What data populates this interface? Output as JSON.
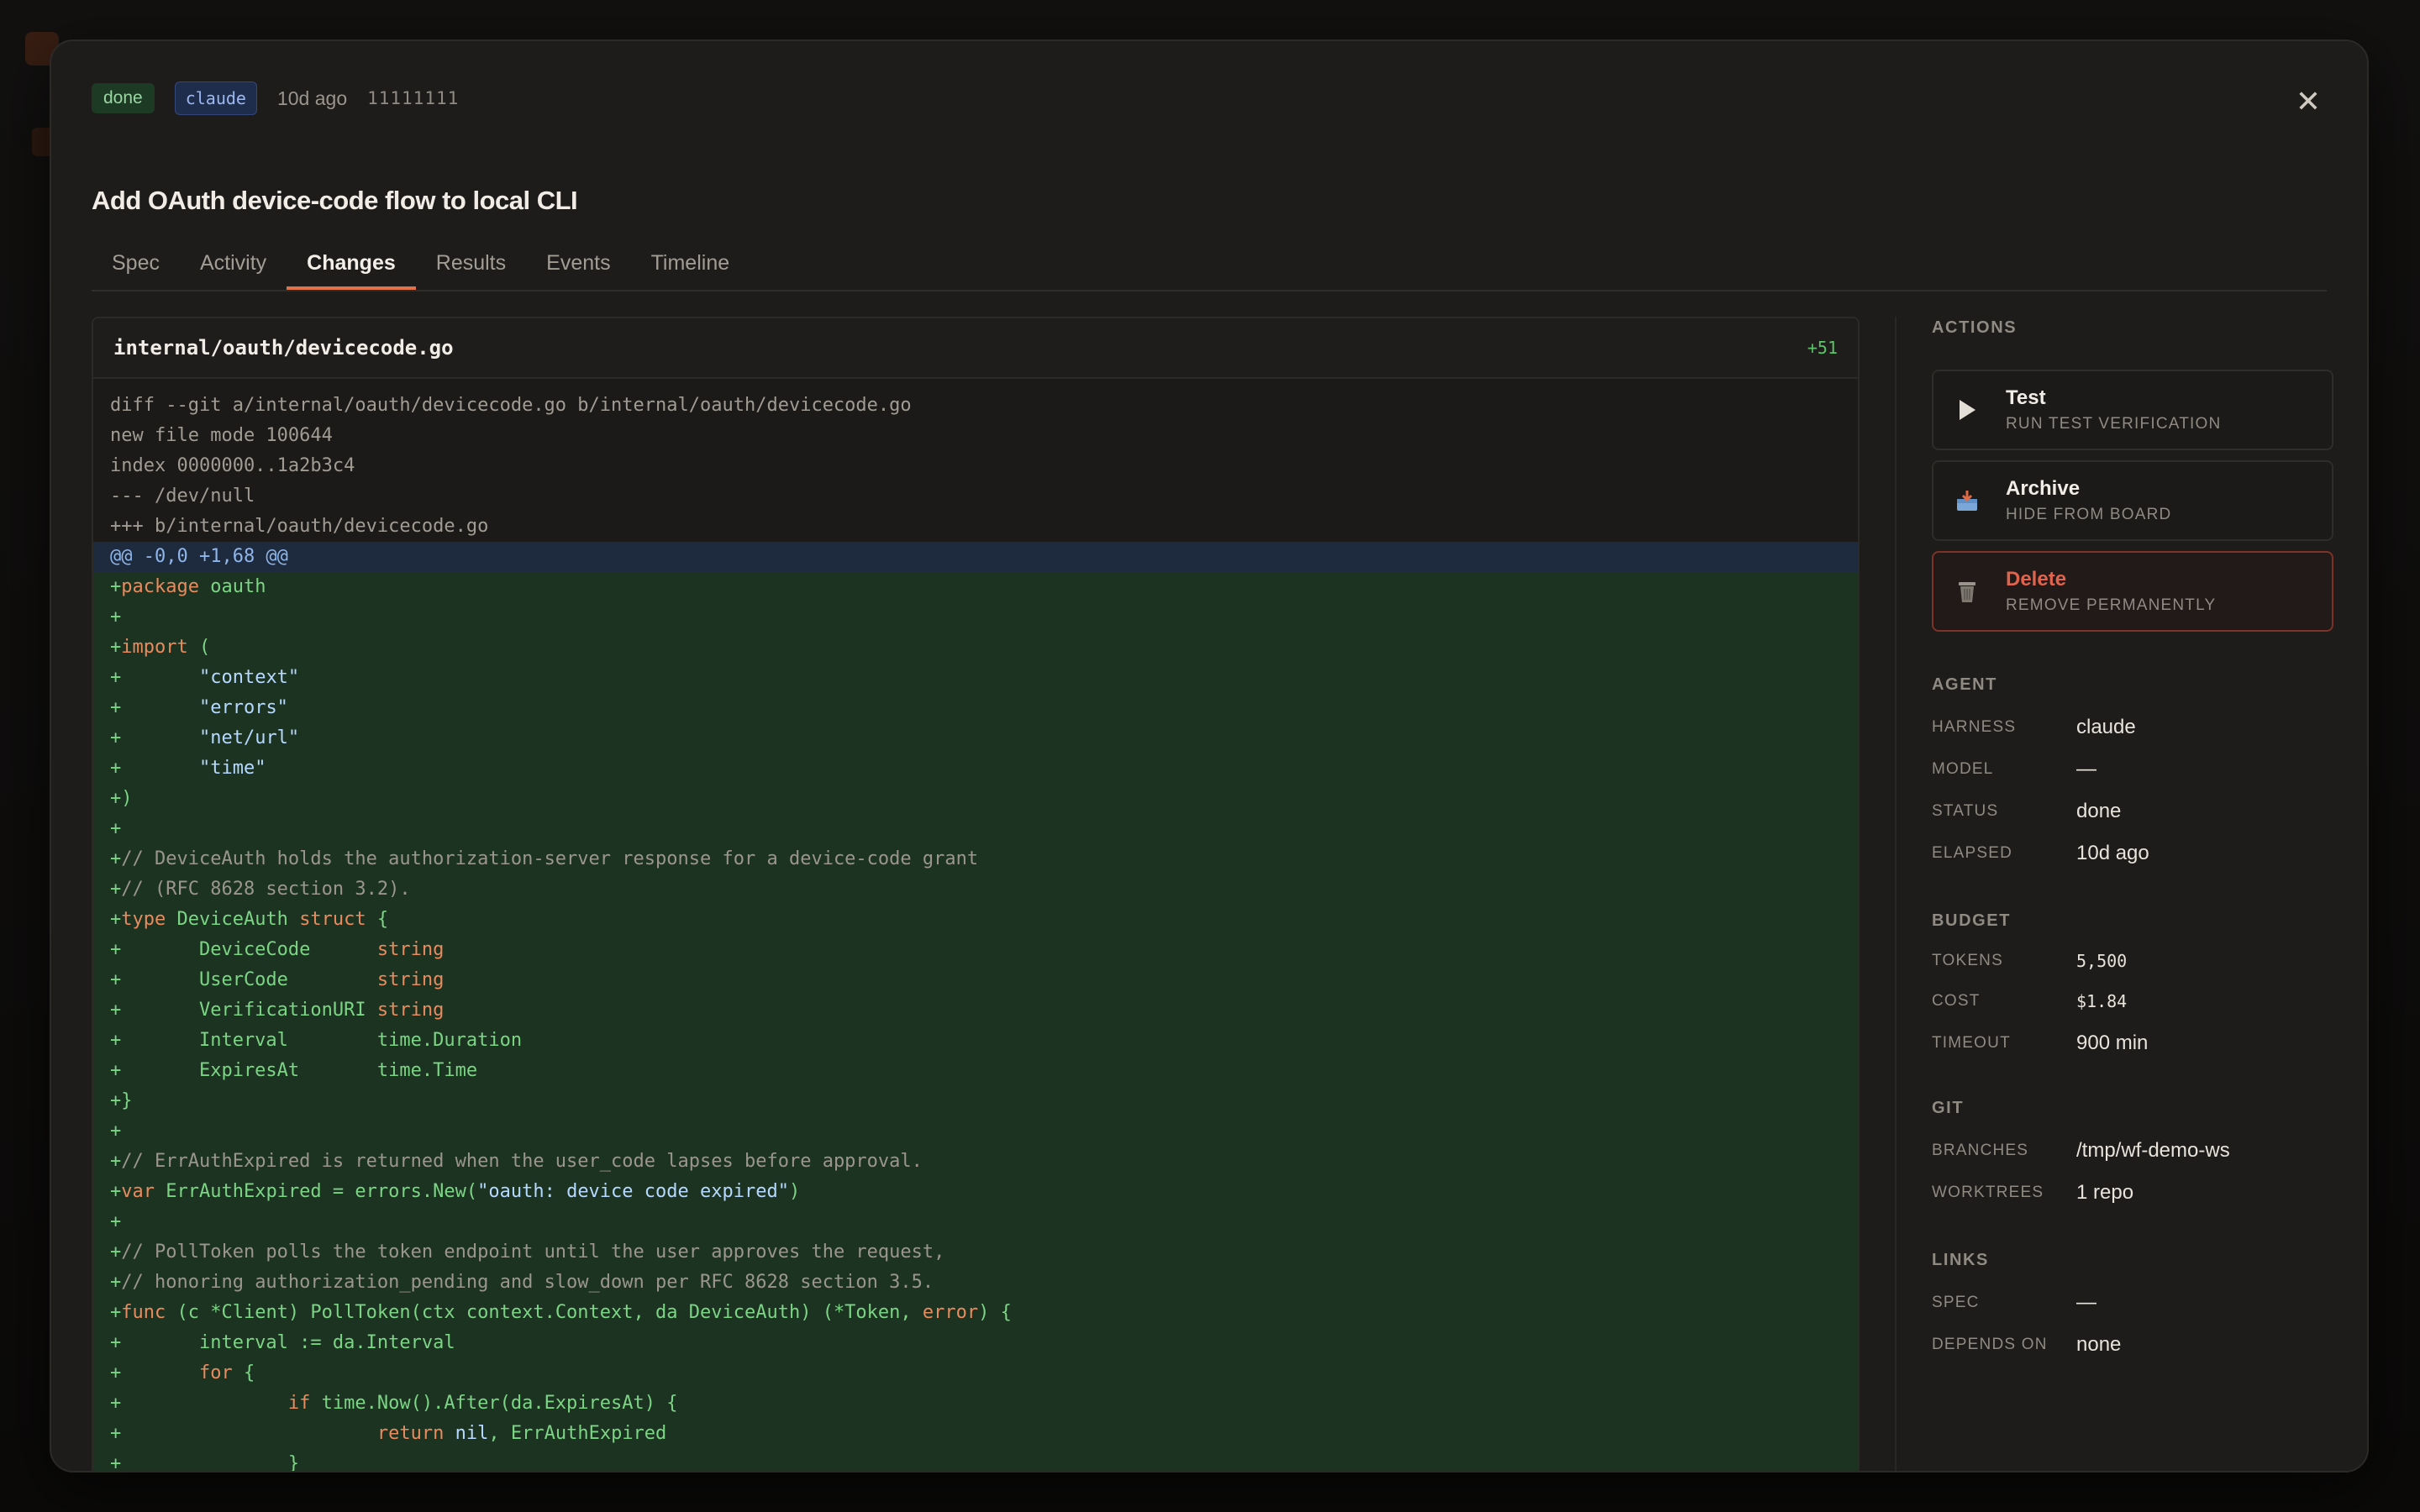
{
  "task": {
    "status_badge": "done",
    "agent_badge": "claude",
    "time_ago": "10d ago",
    "task_id": "11111111",
    "title": "Add OAuth device-code flow to local CLI"
  },
  "tabs": [
    "Spec",
    "Activity",
    "Changes",
    "Results",
    "Events",
    "Timeline"
  ],
  "active_tab": "Changes",
  "diff": {
    "file": "internal/oauth/devicecode.go",
    "count": "+51",
    "lines": [
      {
        "t": "meta",
        "s": [
          [
            "",
            "diff --git a/internal/oauth/devicecode.go b/internal/oauth/devicecode.go"
          ]
        ]
      },
      {
        "t": "meta",
        "s": [
          [
            "",
            "new file mode 100644"
          ]
        ]
      },
      {
        "t": "meta",
        "s": [
          [
            "",
            "index 0000000..1a2b3c4"
          ]
        ]
      },
      {
        "t": "meta",
        "s": [
          [
            "",
            "--- /dev/null"
          ]
        ]
      },
      {
        "t": "meta",
        "s": [
          [
            "",
            "+++ b/internal/oauth/devicecode.go"
          ]
        ]
      },
      {
        "t": "hunk",
        "s": [
          [
            "",
            "@@ -0,0 +1,68 @@"
          ]
        ]
      },
      {
        "t": "add",
        "s": [
          [
            "",
            "+"
          ],
          [
            "kw",
            "package"
          ],
          [
            "",
            " oauth"
          ]
        ]
      },
      {
        "t": "add",
        "s": [
          [
            "",
            "+"
          ]
        ]
      },
      {
        "t": "add",
        "s": [
          [
            "",
            "+"
          ],
          [
            "kw",
            "import"
          ],
          [
            "",
            " ("
          ]
        ]
      },
      {
        "t": "add",
        "s": [
          [
            "",
            "+       "
          ],
          [
            "str",
            "\"context\""
          ]
        ]
      },
      {
        "t": "add",
        "s": [
          [
            "",
            "+       "
          ],
          [
            "str",
            "\"errors\""
          ]
        ]
      },
      {
        "t": "add",
        "s": [
          [
            "",
            "+       "
          ],
          [
            "str",
            "\"net/url\""
          ]
        ]
      },
      {
        "t": "add",
        "s": [
          [
            "",
            "+       "
          ],
          [
            "str",
            "\"time\""
          ]
        ]
      },
      {
        "t": "add",
        "s": [
          [
            "",
            "+)"
          ]
        ]
      },
      {
        "t": "add",
        "s": [
          [
            "",
            "+"
          ]
        ]
      },
      {
        "t": "add",
        "s": [
          [
            "",
            "+"
          ],
          [
            "cm",
            "// DeviceAuth holds the authorization-server response for a device-code grant"
          ]
        ]
      },
      {
        "t": "add",
        "s": [
          [
            "",
            "+"
          ],
          [
            "cm",
            "// (RFC 8628 section 3.2)."
          ]
        ]
      },
      {
        "t": "add",
        "s": [
          [
            "",
            "+"
          ],
          [
            "kw",
            "type"
          ],
          [
            "",
            " DeviceAuth "
          ],
          [
            "kw",
            "struct"
          ],
          [
            "",
            " {"
          ]
        ]
      },
      {
        "t": "add",
        "s": [
          [
            "",
            "+       DeviceCode      "
          ],
          [
            "ty",
            "string"
          ]
        ]
      },
      {
        "t": "add",
        "s": [
          [
            "",
            "+       UserCode        "
          ],
          [
            "ty",
            "string"
          ]
        ]
      },
      {
        "t": "add",
        "s": [
          [
            "",
            "+       VerificationURI "
          ],
          [
            "ty",
            "string"
          ]
        ]
      },
      {
        "t": "add",
        "s": [
          [
            "",
            "+       Interval        time.Duration"
          ]
        ]
      },
      {
        "t": "add",
        "s": [
          [
            "",
            "+       ExpiresAt       time.Time"
          ]
        ]
      },
      {
        "t": "add",
        "s": [
          [
            "",
            "+}"
          ]
        ]
      },
      {
        "t": "add",
        "s": [
          [
            "",
            "+"
          ]
        ]
      },
      {
        "t": "add",
        "s": [
          [
            "",
            "+"
          ],
          [
            "cm",
            "// ErrAuthExpired is returned when the user_code lapses before approval."
          ]
        ]
      },
      {
        "t": "add",
        "s": [
          [
            "",
            "+"
          ],
          [
            "kw",
            "var"
          ],
          [
            "",
            " ErrAuthExpired = errors.New("
          ],
          [
            "str",
            "\"oauth: device code expired\""
          ],
          [
            "",
            ")"
          ]
        ]
      },
      {
        "t": "add",
        "s": [
          [
            "",
            "+"
          ]
        ]
      },
      {
        "t": "add",
        "s": [
          [
            "",
            "+"
          ],
          [
            "cm",
            "// PollToken polls the token endpoint until the user approves the request,"
          ]
        ]
      },
      {
        "t": "add",
        "s": [
          [
            "",
            "+"
          ],
          [
            "cm",
            "// honoring authorization_pending and slow_down per RFC 8628 section 3.5."
          ]
        ]
      },
      {
        "t": "add",
        "s": [
          [
            "",
            "+"
          ],
          [
            "kw",
            "func"
          ],
          [
            "",
            " (c *Client) PollToken(ctx context.Context, da DeviceAuth) (*Token, "
          ],
          [
            "kw",
            "error"
          ],
          [
            "",
            ") {"
          ]
        ]
      },
      {
        "t": "add",
        "s": [
          [
            "",
            "+       interval := da.Interval"
          ]
        ]
      },
      {
        "t": "add",
        "s": [
          [
            "",
            "+       "
          ],
          [
            "kw",
            "for"
          ],
          [
            "",
            " {"
          ]
        ]
      },
      {
        "t": "add",
        "s": [
          [
            "",
            "+               "
          ],
          [
            "kw",
            "if"
          ],
          [
            "",
            " time.Now().After(da.ExpiresAt) {"
          ]
        ]
      },
      {
        "t": "add",
        "s": [
          [
            "",
            "+                       "
          ],
          [
            "kw",
            "return"
          ],
          [
            "",
            " "
          ],
          [
            "str",
            "nil"
          ],
          [
            "",
            ", ErrAuthExpired"
          ]
        ]
      },
      {
        "t": "add",
        "s": [
          [
            "",
            "+               }"
          ]
        ]
      }
    ]
  },
  "sidebar": {
    "actions_title": "ACTIONS",
    "actions": [
      {
        "label": "Test",
        "sub": "RUN TEST VERIFICATION",
        "icon": "play-icon",
        "glyph": "▶"
      },
      {
        "label": "Archive",
        "sub": "HIDE FROM BOARD",
        "icon": "archive-icon",
        "glyph": "📥"
      },
      {
        "label": "Delete",
        "sub": "REMOVE PERMANENTLY",
        "icon": "trash-icon",
        "glyph": "🗑"
      }
    ],
    "agent_title": "AGENT",
    "agent": [
      {
        "k": "HARNESS",
        "v": "claude"
      },
      {
        "k": "MODEL",
        "v": "—"
      },
      {
        "k": "STATUS",
        "v": "done"
      },
      {
        "k": "ELAPSED",
        "v": "10d ago"
      }
    ],
    "budget_title": "BUDGET",
    "budget": [
      {
        "k": "TOKENS",
        "v": "5,500"
      },
      {
        "k": "COST",
        "v": "$1.84"
      },
      {
        "k": "TIMEOUT",
        "v": "900 min"
      }
    ],
    "git_title": "GIT",
    "git": [
      {
        "k": "BRANCHES",
        "v": "/tmp/wf-demo-ws"
      },
      {
        "k": "WORKTREES",
        "v": "1 repo"
      }
    ],
    "links_title": "LINKS",
    "links": [
      {
        "k": "SPEC",
        "v": "—"
      },
      {
        "k": "DEPENDS ON",
        "v": "none"
      }
    ]
  }
}
